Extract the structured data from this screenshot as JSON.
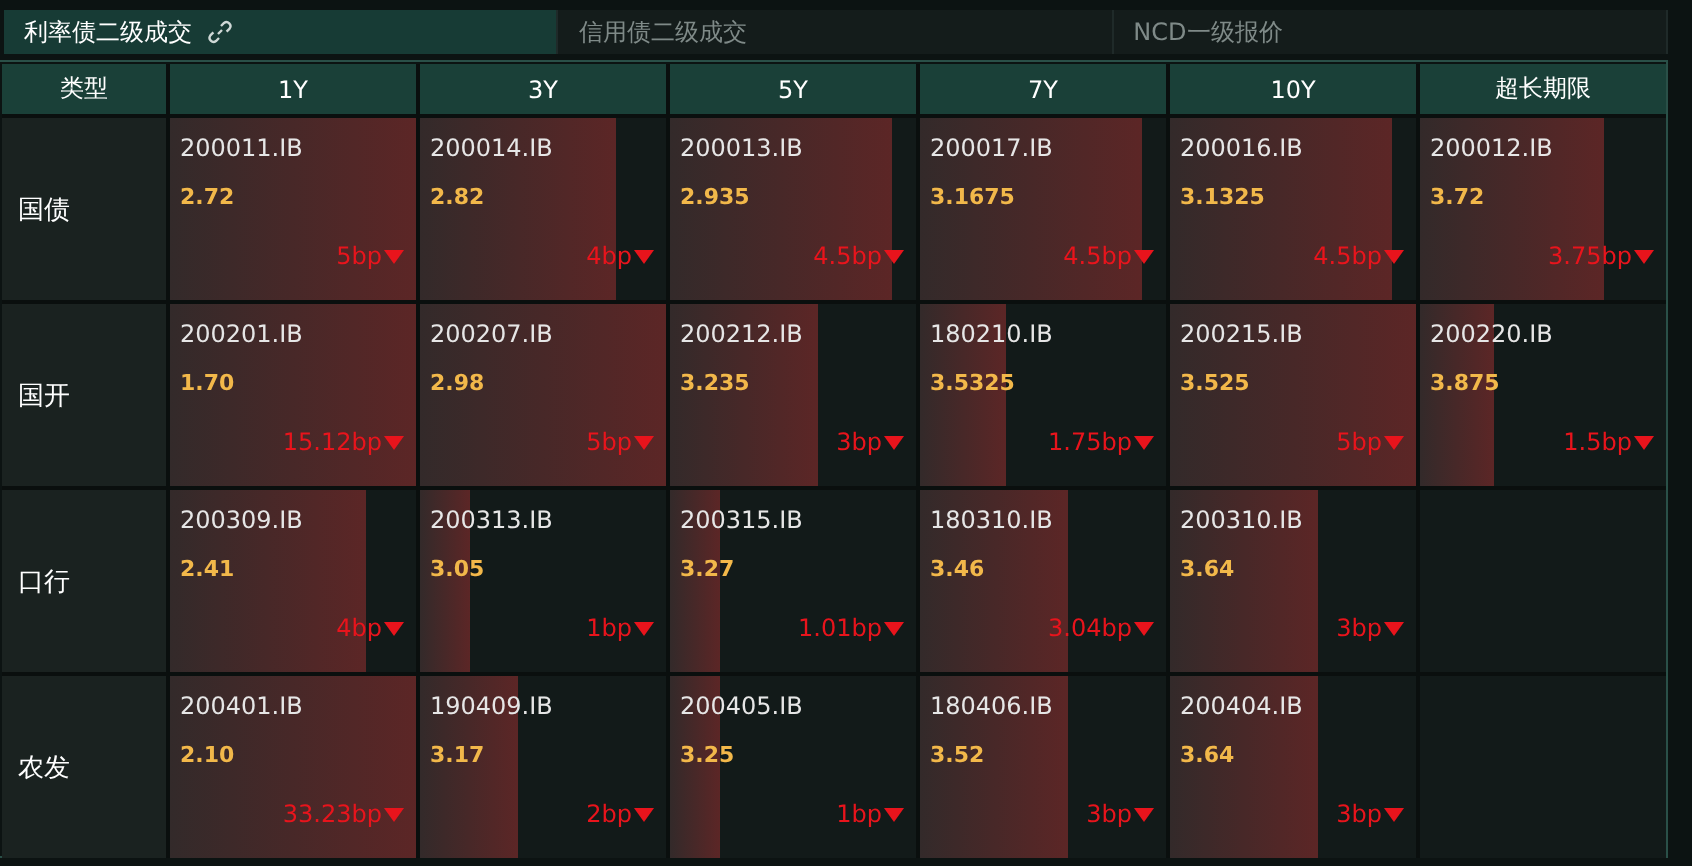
{
  "tabs": [
    {
      "label": "利率债二级成交",
      "selected": true,
      "link_icon": true
    },
    {
      "label": "信用债二级成交",
      "selected": false,
      "link_icon": false
    },
    {
      "label": "NCD一级报价",
      "selected": false,
      "link_icon": false
    }
  ],
  "table": {
    "columns": [
      "类型",
      "1Y",
      "3Y",
      "5Y",
      "7Y",
      "10Y",
      "超长期限"
    ],
    "rows": [
      {
        "cells": [
          {
            "kind": "label",
            "text": "国债"
          },
          {
            "kind": "quote",
            "code": "200011.IB",
            "yield": "2.72",
            "change": "5bp",
            "falling": true,
            "level": 1
          },
          {
            "kind": "quote",
            "code": "200014.IB",
            "yield": "2.82",
            "change": "4bp",
            "falling": true,
            "level": 0.8
          },
          {
            "kind": "quote",
            "code": "200013.IB",
            "yield": "2.935",
            "change": "4.5bp",
            "falling": true,
            "level": 0.9
          },
          {
            "kind": "quote",
            "code": "200017.IB",
            "yield": "3.1675",
            "change": "4.5bp",
            "falling": true,
            "level": 0.9
          },
          {
            "kind": "quote",
            "code": "200016.IB",
            "yield": "3.1325",
            "change": "4.5bp",
            "falling": true,
            "level": 0.9
          },
          {
            "kind": "quote",
            "code": "200012.IB",
            "yield": "3.72",
            "change": "3.75bp",
            "falling": true,
            "level": 0.75
          }
        ]
      },
      {
        "cells": [
          {
            "kind": "label",
            "text": "国开"
          },
          {
            "kind": "quote",
            "code": "200201.IB",
            "yield": "1.70",
            "change": "15.12bp",
            "falling": true,
            "level": 1
          },
          {
            "kind": "quote",
            "code": "200207.IB",
            "yield": "2.98",
            "change": "5bp",
            "falling": true,
            "level": 1
          },
          {
            "kind": "quote",
            "code": "200212.IB",
            "yield": "3.235",
            "change": "3bp",
            "falling": true,
            "level": 0.6
          },
          {
            "kind": "quote",
            "code": "180210.IB",
            "yield": "3.5325",
            "change": "1.75bp",
            "falling": true,
            "level": 0.35
          },
          {
            "kind": "quote",
            "code": "200215.IB",
            "yield": "3.525",
            "change": "5bp",
            "falling": true,
            "level": 1
          },
          {
            "kind": "quote",
            "code": "200220.IB",
            "yield": "3.875",
            "change": "1.5bp",
            "falling": true,
            "level": 0.3
          }
        ]
      },
      {
        "cells": [
          {
            "kind": "label",
            "text": "口行"
          },
          {
            "kind": "quote",
            "code": "200309.IB",
            "yield": "2.41",
            "change": "4bp",
            "falling": true,
            "level": 0.8
          },
          {
            "kind": "quote",
            "code": "200313.IB",
            "yield": "3.05",
            "change": "1bp",
            "falling": true,
            "level": 0.2
          },
          {
            "kind": "quote",
            "code": "200315.IB",
            "yield": "3.27",
            "change": "1.01bp",
            "falling": true,
            "level": 0.2
          },
          {
            "kind": "quote",
            "code": "180310.IB",
            "yield": "3.46",
            "change": "3.04bp",
            "falling": true,
            "level": 0.6
          },
          {
            "kind": "quote",
            "code": "200310.IB",
            "yield": "3.64",
            "change": "3bp",
            "falling": true,
            "level": 0.6
          },
          {
            "kind": "empty"
          }
        ]
      },
      {
        "cells": [
          {
            "kind": "label",
            "text": "农发"
          },
          {
            "kind": "quote",
            "code": "200401.IB",
            "yield": "2.10",
            "change": "33.23bp",
            "falling": true,
            "level": 1
          },
          {
            "kind": "quote",
            "code": "190409.IB",
            "yield": "3.17",
            "change": "2bp",
            "falling": true,
            "level": 0.4
          },
          {
            "kind": "quote",
            "code": "200405.IB",
            "yield": "3.25",
            "change": "1bp",
            "falling": true,
            "level": 0.2
          },
          {
            "kind": "quote",
            "code": "180406.IB",
            "yield": "3.52",
            "change": "3bp",
            "falling": true,
            "level": 0.6
          },
          {
            "kind": "quote",
            "code": "200404.IB",
            "yield": "3.64",
            "change": "3bp",
            "falling": true,
            "level": 0.6
          },
          {
            "kind": "empty"
          }
        ]
      }
    ]
  }
}
